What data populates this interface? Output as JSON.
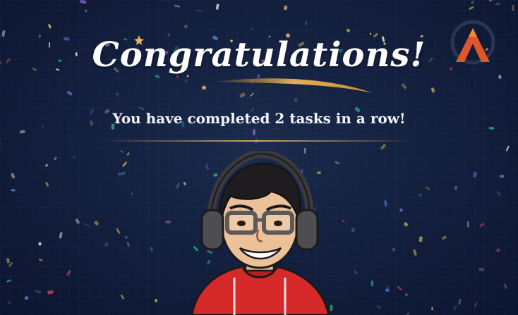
{
  "banner": {
    "title": "Congratulations!",
    "subtitle": "You have completed 2 tasks in a row!"
  },
  "logo": {
    "icon": "brand-a-logo",
    "colors": [
      "#d9451f",
      "#f08a34"
    ]
  },
  "avatar": {
    "icon": "cartoon-avatar-with-headphones"
  },
  "colors": {
    "background": "#13203f",
    "accent_gold": "#d9a566",
    "hoodie_red": "#d62a2a"
  }
}
